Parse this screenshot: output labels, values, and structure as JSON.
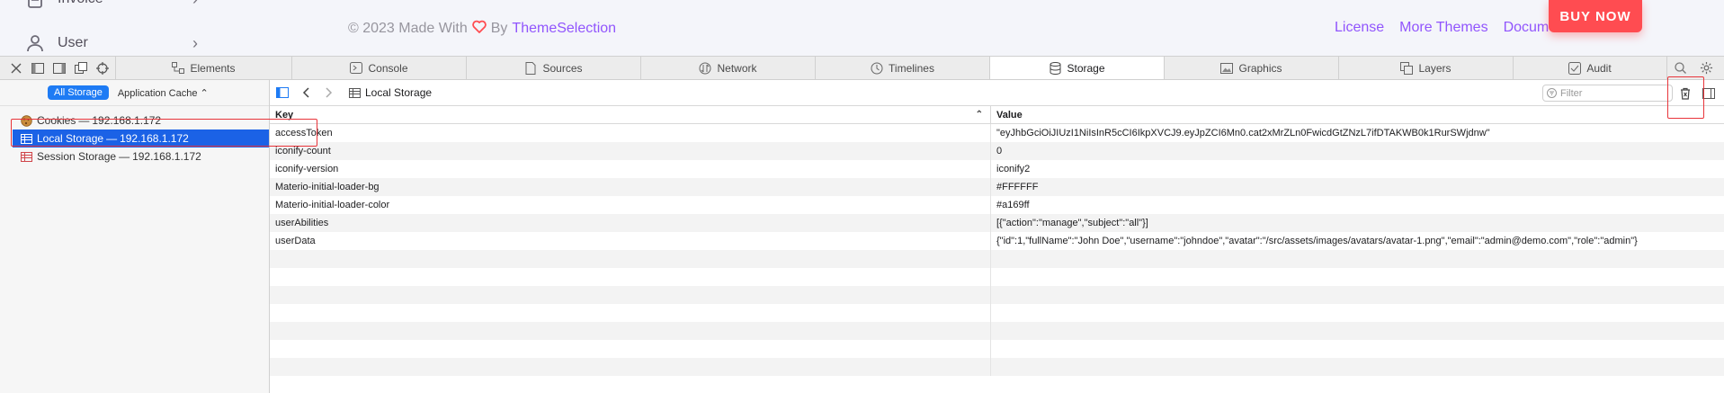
{
  "webpage": {
    "sidebar": [
      {
        "label": "Invoice",
        "icon": "document-icon"
      },
      {
        "label": "User",
        "icon": "user-icon"
      }
    ],
    "footer": {
      "prefix": "© 2023 Made With",
      "by": "By",
      "brand": "ThemeSelection",
      "links": [
        "License",
        "More Themes",
        "Documentation"
      ]
    },
    "buy_now": "BUY NOW",
    "colors": {
      "accent": "#9155fd",
      "buy_now": "#ff4c51"
    }
  },
  "devtools": {
    "tabs": [
      {
        "label": "Elements",
        "icon": "elements-icon"
      },
      {
        "label": "Console",
        "icon": "console-icon"
      },
      {
        "label": "Sources",
        "icon": "sources-icon"
      },
      {
        "label": "Network",
        "icon": "network-icon"
      },
      {
        "label": "Timelines",
        "icon": "timelines-icon"
      },
      {
        "label": "Storage",
        "icon": "storage-icon",
        "active": true
      },
      {
        "label": "Graphics",
        "icon": "graphics-icon"
      },
      {
        "label": "Layers",
        "icon": "layers-icon"
      },
      {
        "label": "Audit",
        "icon": "audit-icon"
      }
    ],
    "sidebar": {
      "scope_all": "All Storage",
      "scope_select": "Application Cache",
      "items": [
        {
          "label": "Cookies",
          "host": "192.168.1.172",
          "icon": "cookie-icon"
        },
        {
          "label": "Local Storage",
          "host": "192.168.1.172",
          "icon": "table-icon",
          "selected": true
        },
        {
          "label": "Session Storage",
          "host": "192.168.1.172",
          "icon": "table-icon"
        }
      ],
      "separator": "—"
    },
    "content": {
      "breadcrumb": "Local Storage",
      "filter_placeholder": "Filter",
      "columns": {
        "key": "Key",
        "value": "Value"
      },
      "rows": [
        {
          "key": "accessToken",
          "value": "\"eyJhbGciOiJIUzI1NiIsInR5cCI6IkpXVCJ9.eyJpZCI6Mn0.cat2xMrZLn0FwicdGtZNzL7ifDTAKWB0k1RurSWjdnw\""
        },
        {
          "key": "iconify-count",
          "value": "0"
        },
        {
          "key": "iconify-version",
          "value": "iconify2"
        },
        {
          "key": "Materio-initial-loader-bg",
          "value": "#FFFFFF"
        },
        {
          "key": "Materio-initial-loader-color",
          "value": "#a169ff"
        },
        {
          "key": "userAbilities",
          "value": "[{\"action\":\"manage\",\"subject\":\"all\"}]"
        },
        {
          "key": "userData",
          "value": "{\"id\":1,\"fullName\":\"John Doe\",\"username\":\"johndoe\",\"avatar\":\"/src/assets/images/avatars/avatar-1.png\",\"email\":\"admin@demo.com\",\"role\":\"admin\"}"
        }
      ]
    },
    "colors": {
      "selection": "#1b62e6",
      "scope_pill": "#1e7bf4",
      "annotation": "#e8343a"
    }
  }
}
